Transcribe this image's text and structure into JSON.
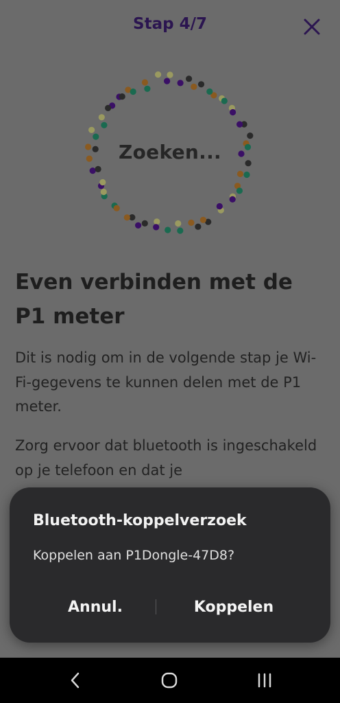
{
  "header": {
    "step_title": "Stap 4/7"
  },
  "search": {
    "label": "Zoeken..."
  },
  "content": {
    "heading": "Even verbinden met de P1 meter",
    "paragraph_1": "Dit is nodig om in de volgende stap je Wi-Fi-gegevens te kunnen delen met de P1 meter.",
    "paragraph_2": "Zorg ervoor dat bluetooth is ingeschakeld op je telefoon en dat je"
  },
  "dialog": {
    "title": "Bluetooth-koppelverzoek",
    "message": "Koppelen aan P1Dongle-47D8?",
    "cancel_label": "Annul.",
    "confirm_label": "Koppelen"
  },
  "navbar": {
    "back_icon": "back-icon",
    "home_icon": "home-icon",
    "recents_icon": "recents-icon"
  },
  "colors": {
    "accent": "#2b1550",
    "dialog_bg": "#2a2a2c",
    "scrim": "#6b6b6b",
    "dot_palette": [
      "#3a0f66",
      "#1a6a50",
      "#2a2a2a",
      "#9a9a60",
      "#8a5a20"
    ]
  }
}
